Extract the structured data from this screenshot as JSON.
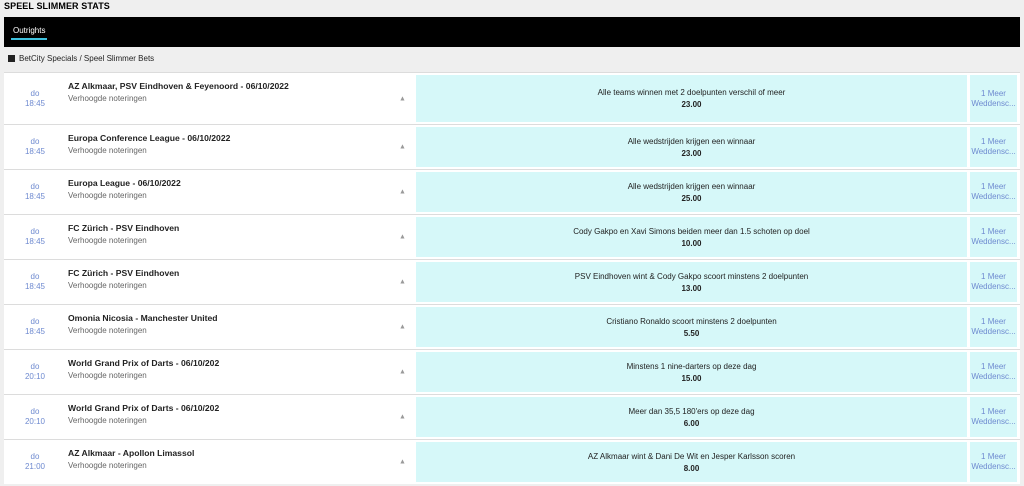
{
  "page_title": "SPEEL SLIMMER STATS",
  "tabs": [
    {
      "label": "Outrights"
    }
  ],
  "breadcrumb": "BetCity Specials / Speel Slimmer Bets",
  "rows": [
    {
      "day": "do",
      "time": "18:45",
      "event": "AZ Alkmaar, PSV Eindhoven & Feyenoord - 06/10/2022",
      "sub": "Verhoogde noteringen",
      "market": "Alle teams winnen met 2 doelpunten verschil of meer",
      "odds": "23.00",
      "more1": "1 Meer",
      "more2": "Weddensc..."
    },
    {
      "day": "do",
      "time": "18:45",
      "event": "Europa Conference League - 06/10/2022",
      "sub": "Verhoogde noteringen",
      "market": "Alle wedstrijden krijgen een winnaar",
      "odds": "23.00",
      "more1": "1 Meer",
      "more2": "Weddensc..."
    },
    {
      "day": "do",
      "time": "18:45",
      "event": "Europa League - 06/10/2022",
      "sub": "Verhoogde noteringen",
      "market": "Alle wedstrijden krijgen een winnaar",
      "odds": "25.00",
      "more1": "1 Meer",
      "more2": "Weddensc..."
    },
    {
      "day": "do",
      "time": "18:45",
      "event": "FC Zürich - PSV Eindhoven",
      "sub": "Verhoogde noteringen",
      "market": "Cody Gakpo en Xavi Simons beiden meer dan 1.5 schoten op doel",
      "odds": "10.00",
      "more1": "1 Meer",
      "more2": "Weddensc..."
    },
    {
      "day": "do",
      "time": "18:45",
      "event": "FC Zürich - PSV Eindhoven",
      "sub": "Verhoogde noteringen",
      "market": "PSV Eindhoven wint & Cody Gakpo scoort minstens 2 doelpunten",
      "odds": "13.00",
      "more1": "1 Meer",
      "more2": "Weddensc..."
    },
    {
      "day": "do",
      "time": "18:45",
      "event": "Omonia Nicosia - Manchester United",
      "sub": "Verhoogde noteringen",
      "market": "Cristiano Ronaldo scoort minstens 2 doelpunten",
      "odds": "5.50",
      "more1": "1 Meer",
      "more2": "Weddensc..."
    },
    {
      "day": "do",
      "time": "20:10",
      "event": "World Grand Prix of Darts - 06/10/202",
      "sub": "Verhoogde noteringen",
      "market": "Minstens 1 nine-darters op deze dag",
      "odds": "15.00",
      "more1": "1 Meer",
      "more2": "Weddensc..."
    },
    {
      "day": "do",
      "time": "20:10",
      "event": "World Grand Prix of Darts - 06/10/202",
      "sub": "Verhoogde noteringen",
      "market": "Meer dan 35,5 180'ers op deze dag",
      "odds": "6.00",
      "more1": "1 Meer",
      "more2": "Weddensc..."
    },
    {
      "day": "do",
      "time": "21:00",
      "event": "AZ Alkmaar - Apollon Limassol",
      "sub": "Verhoogde noteringen",
      "market": "AZ Alkmaar wint & Dani De Wit en Jesper Karlsson scoren",
      "odds": "8.00",
      "more1": "1 Meer",
      "more2": "Weddensc..."
    }
  ],
  "colors": {
    "tabbar": "#000000",
    "tab_underline": "#3fc2de",
    "market_bg": "#d6f8f9",
    "time_text": "#6e8ad0"
  },
  "icons": {
    "row_arrow": "triangle-up-icon",
    "breadcrumb": "square-icon"
  }
}
